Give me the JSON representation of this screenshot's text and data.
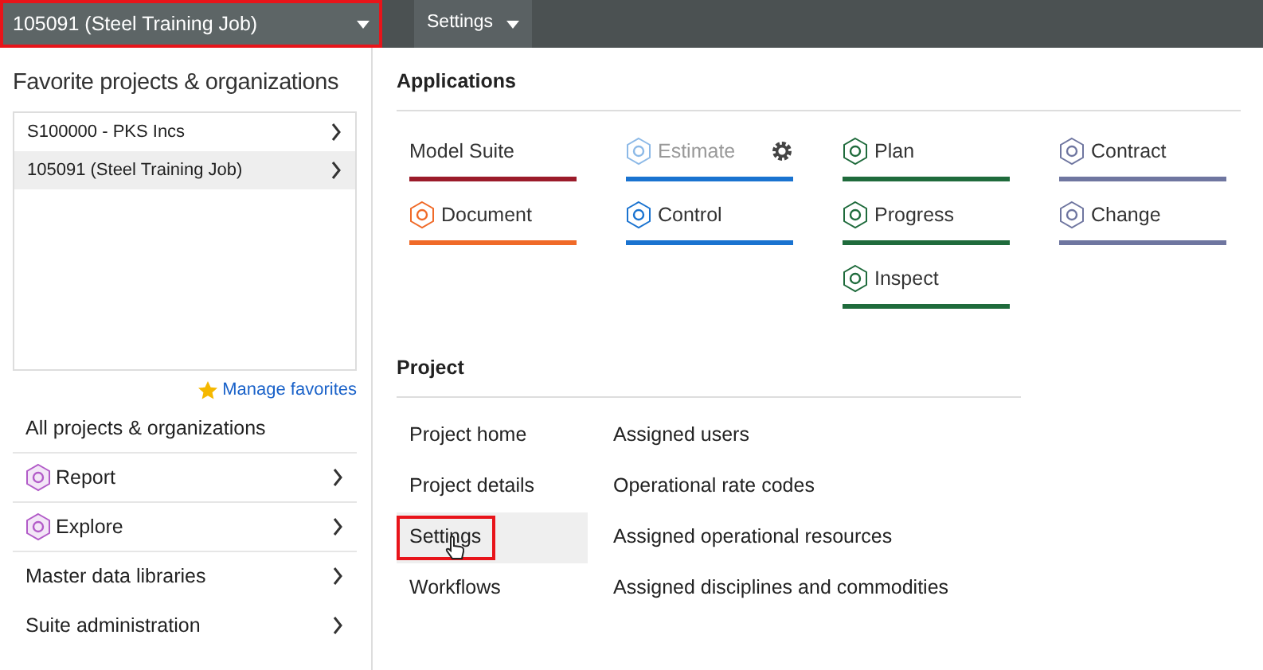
{
  "header": {
    "project_selector": {
      "label": "105091 (Steel Training Job)",
      "highlighted": true
    },
    "settings_menu": {
      "label": "Settings"
    }
  },
  "favorites": {
    "title": "Favorite projects & organizations",
    "items": [
      {
        "label": "S100000 - PKS Incs",
        "selected": false
      },
      {
        "label": "105091 (Steel Training Job)",
        "selected": true
      }
    ],
    "manage_link": "Manage favorites"
  },
  "nav": [
    {
      "label": "All projects & organizations",
      "kind": "link"
    },
    {
      "label": "Report",
      "kind": "app_menu"
    },
    {
      "label": "Explore",
      "kind": "app_menu"
    },
    {
      "label": "Master data libraries",
      "kind": "submenu"
    },
    {
      "label": "Suite administration",
      "kind": "submenu"
    }
  ],
  "applications": {
    "title": "Applications",
    "columns": [
      [
        {
          "label": "Model Suite",
          "color": "#9b1b2a",
          "kind": "plain",
          "disabled": false
        },
        {
          "label": "Document",
          "color": "#f06a28",
          "kind": "app",
          "disabled": false
        }
      ],
      [
        {
          "label": "Estimate",
          "color": "#1a73d0",
          "kind": "app",
          "disabled": true,
          "has_settings": true
        },
        {
          "label": "Control",
          "color": "#1a73d0",
          "kind": "app",
          "disabled": false
        }
      ],
      [
        {
          "label": "Plan",
          "color": "#1f6b3c",
          "kind": "app",
          "disabled": false
        },
        {
          "label": "Progress",
          "color": "#1f6b3c",
          "kind": "app",
          "disabled": false
        },
        {
          "label": "Inspect",
          "color": "#1f6b3c",
          "kind": "app",
          "disabled": false
        }
      ],
      [
        {
          "label": "Contract",
          "color": "#6f76a0",
          "kind": "app",
          "disabled": false
        },
        {
          "label": "Change",
          "color": "#6f76a0",
          "kind": "app",
          "disabled": false
        }
      ]
    ]
  },
  "project": {
    "title": "Project",
    "links": [
      {
        "label": "Project home",
        "selected": false,
        "highlighted": false,
        "hovered": false
      },
      {
        "label": "Project details",
        "selected": false,
        "highlighted": false,
        "hovered": false
      },
      {
        "label": "Settings",
        "selected": true,
        "highlighted": true,
        "hovered": true
      },
      {
        "label": "Workflows",
        "selected": false,
        "highlighted": false,
        "hovered": false
      }
    ],
    "assigned_links": [
      {
        "label": "Assigned users"
      },
      {
        "label": "Operational rate codes"
      },
      {
        "label": "Assigned operational resources"
      },
      {
        "label": "Assigned disciplines and commodities"
      }
    ]
  }
}
